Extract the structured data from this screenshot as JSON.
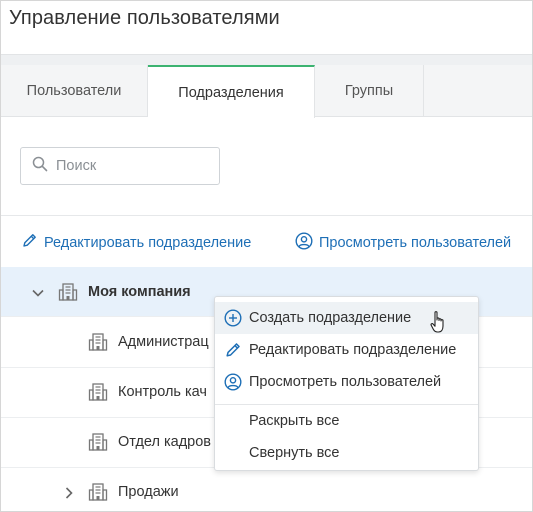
{
  "header": {
    "title": "Управление пользователями"
  },
  "tabs": [
    {
      "label": "Пользователи",
      "active": false
    },
    {
      "label": "Подразделения",
      "active": true
    },
    {
      "label": "Группы",
      "active": false
    }
  ],
  "search": {
    "placeholder": "Поиск",
    "value": ""
  },
  "toolbar": {
    "edit_label": "Редактировать подразделение",
    "view_label": "Просмотреть пользователей"
  },
  "tree": {
    "root": {
      "label": "Моя компания",
      "expanded": true
    },
    "children": [
      {
        "label": "Администрац"
      },
      {
        "label": "Контроль кач"
      },
      {
        "label": "Отдел кадров"
      },
      {
        "label": "Продажи",
        "expandable": true
      }
    ]
  },
  "context_menu": {
    "items": [
      {
        "label": "Создать подразделение",
        "icon": "plus-circle-icon"
      },
      {
        "label": "Редактировать подразделение",
        "icon": "pencil-icon"
      },
      {
        "label": "Просмотреть пользователей",
        "icon": "user-circle-icon"
      },
      {
        "label": "Раскрыть все"
      },
      {
        "label": "Свернуть все"
      }
    ]
  },
  "colors": {
    "accent": "#1e6fb6",
    "active_tab_border": "#3cb371",
    "selected_row": "#e7f1fb"
  }
}
